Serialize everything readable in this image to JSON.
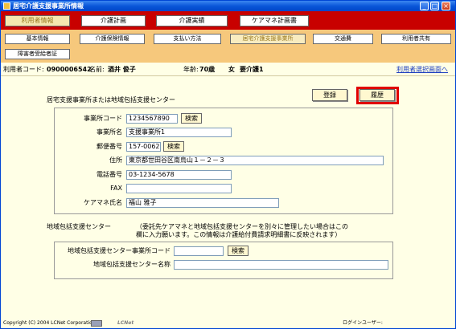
{
  "window": {
    "title": "居宅介護支援事業所情報"
  },
  "main_tabs": [
    {
      "label": "利用者情報",
      "active": true
    },
    {
      "label": "介護計画",
      "active": false
    },
    {
      "label": "介護実績",
      "active": false
    },
    {
      "label": "ケアマネ計画書",
      "active": false
    }
  ],
  "sub_tabs": [
    {
      "label": "基本情報",
      "active": false
    },
    {
      "label": "介護保険情報",
      "active": false
    },
    {
      "label": "支払い方法",
      "active": false
    },
    {
      "label": "居宅介護支援事業所",
      "active": true
    },
    {
      "label": "交通費",
      "active": false
    },
    {
      "label": "利用者共有",
      "active": false
    },
    {
      "label": "障害者受給者証",
      "active": false
    }
  ],
  "user": {
    "code_label": "利用者コード:",
    "code": "0900006542",
    "name_label": "名前:",
    "name": "酒井 俊子",
    "age_label": "年齢:",
    "age": "70歳",
    "gender": "女",
    "care_level": "要介護1",
    "select_link": "利用者選択画面へ"
  },
  "actions": {
    "register": "登録",
    "history": "履歴"
  },
  "office": {
    "section_title": "居宅支援事業所または地域包括支援センター",
    "code_label": "事業所コード",
    "code": "1234567890",
    "search": "検索",
    "name_label": "事業所名",
    "name": "支援事業所1",
    "zip_label": "郵便番号",
    "zip": "157-0062",
    "address_label": "住所",
    "address": "東京都世田谷区南烏山１－２－３",
    "phone_label": "電話番号",
    "phone": "03-1234-5678",
    "fax_label": "FAX",
    "fax": "",
    "caremanager_label": "ケアマネ氏名",
    "caremanager": "福山 雅子"
  },
  "center": {
    "section_title": "地域包括支援センター",
    "note_line1": "（委託先ケアマネと地域包括支援センターを別々に管理したい場合はこの",
    "note_line2": "欄に入力願います。この情報は介護給付費請求明細書に反映されます）",
    "code_label": "地域包括支援センター事業所コード",
    "code": "",
    "search": "検索",
    "name_label": "地域包括支援センター名称",
    "name": ""
  },
  "status": {
    "copyright": "Copyright (C) 2004 LCNet Corporation",
    "logo": "LCNet",
    "login_label": "ログインユーザー:"
  }
}
